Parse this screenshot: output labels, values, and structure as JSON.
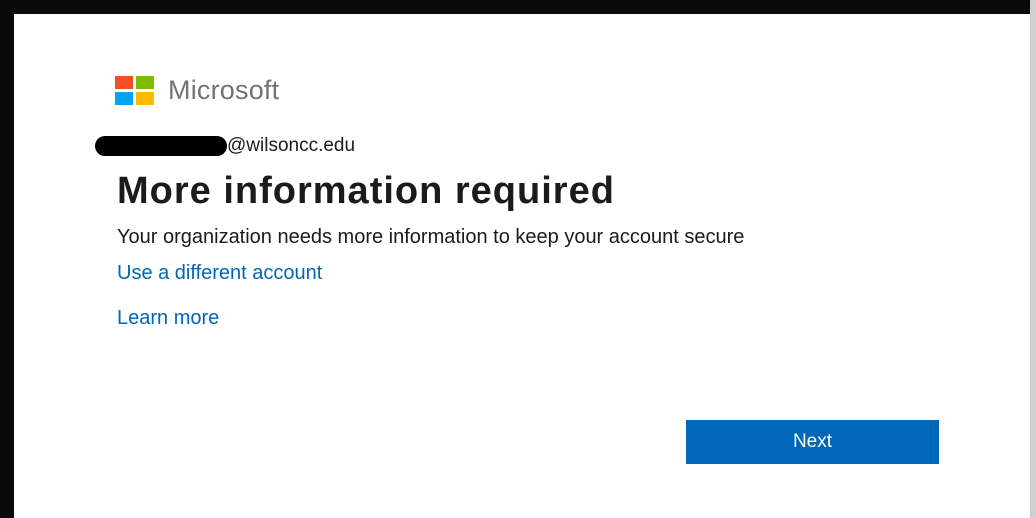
{
  "brand": {
    "name": "Microsoft",
    "logo_colors": [
      "#f25022",
      "#7fba00",
      "#00a4ef",
      "#ffb900"
    ]
  },
  "account": {
    "domain": "@wilsoncc.edu"
  },
  "page": {
    "title": "More information required",
    "description": "Your organization needs more information to keep your account secure"
  },
  "links": {
    "different_account": "Use a different account",
    "learn_more": "Learn more"
  },
  "actions": {
    "next_label": "Next"
  },
  "colors": {
    "accent": "#0067b8",
    "text": "#1b1b1b"
  }
}
